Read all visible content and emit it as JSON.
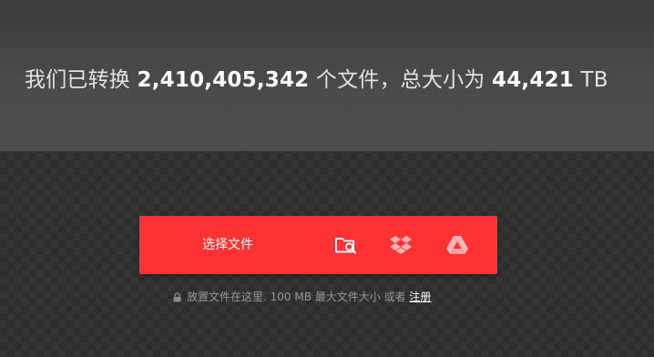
{
  "stats": {
    "prefix": "我们已转换 ",
    "files_count": "2,410,405,342",
    "middle": " 个文件，总大小为 ",
    "total_size": "44,421",
    "unit": " TB"
  },
  "upload": {
    "choose_label": "选择文件",
    "accent_color": "#ff3333",
    "icons": [
      "folder-search-icon",
      "dropbox-icon",
      "google-drive-icon"
    ]
  },
  "hint": {
    "text": "放置文件在这里. 100 MB 最大文件大小 或者 ",
    "signup_link": "注册"
  }
}
